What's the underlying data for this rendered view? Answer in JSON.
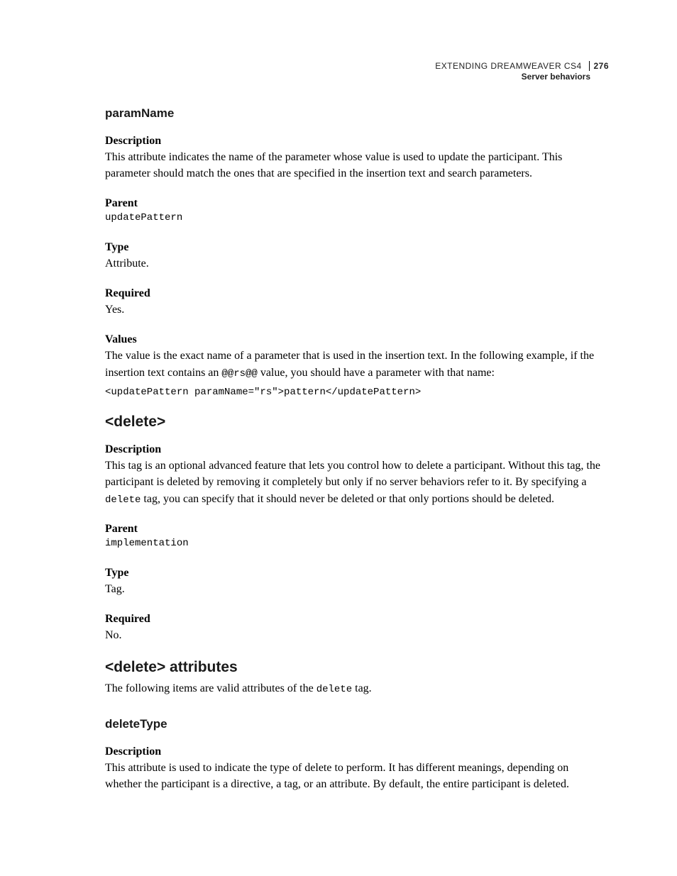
{
  "header": {
    "doc_title": "EXTENDING DREAMWEAVER CS4",
    "page_number": "276",
    "section": "Server behaviors"
  },
  "s1": {
    "title": "paramName",
    "desc_label": "Description",
    "desc_body": "This attribute indicates the name of the parameter whose value is used to update the participant. This parameter should match the ones that are specified in the insertion text and search parameters.",
    "parent_label": "Parent",
    "parent_value": "updatePattern",
    "type_label": "Type",
    "type_value": "Attribute.",
    "required_label": "Required",
    "required_value": "Yes.",
    "values_label": "Values",
    "values_body_pre": "The value is the exact name of a parameter that is used in the insertion text. In the following example, if the insertion text contains an ",
    "values_inline_code": "@@rs@@",
    "values_body_post": " value, you should have a parameter with that name:",
    "values_code": "<updatePattern paramName=\"rs\">pattern</updatePattern>"
  },
  "s2": {
    "title": "<delete>",
    "desc_label": "Description",
    "desc_body_pre": "This tag is an optional advanced feature that lets you control how to delete a participant. Without this tag, the participant is deleted by removing it completely but only if no server behaviors refer to it. By specifying a ",
    "desc_inline_code": "delete",
    "desc_body_post": " tag, you can specify that it should never be deleted or that only portions should be deleted.",
    "parent_label": "Parent",
    "parent_value": "implementation",
    "type_label": "Type",
    "type_value": "Tag.",
    "required_label": "Required",
    "required_value": "No."
  },
  "s3": {
    "title": "<delete> attributes",
    "intro_pre": "The following items are valid attributes of the ",
    "intro_code": "delete",
    "intro_post": " tag."
  },
  "s4": {
    "title": "deleteType",
    "desc_label": "Description",
    "desc_body": "This attribute is used to indicate the type of delete to perform. It has different meanings, depending on whether the participant is a directive, a tag, or an attribute. By default, the entire participant is deleted."
  }
}
